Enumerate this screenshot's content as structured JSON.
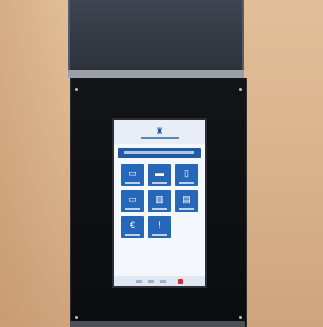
{
  "scene": {
    "colors": {
      "wall": "#d9b48e",
      "panel": "#0b0c0e",
      "frame": "#2c313a",
      "screen_bg": "#f4f7fb",
      "tile": "#2667b8",
      "accent_red": "#cf2d2d"
    },
    "kiosk": {
      "tiles": [
        {
          "icon": "card-icon",
          "glyph": "▭"
        },
        {
          "icon": "car-icon",
          "glyph": "▬"
        },
        {
          "icon": "document-icon",
          "glyph": "▯"
        },
        {
          "icon": "id-card-icon",
          "glyph": "▭"
        },
        {
          "icon": "chart-icon",
          "glyph": "▥"
        },
        {
          "icon": "form-icon",
          "glyph": "▤"
        },
        {
          "icon": "euro-icon",
          "glyph": "€"
        },
        {
          "icon": "info-icon",
          "glyph": "!"
        }
      ]
    }
  }
}
